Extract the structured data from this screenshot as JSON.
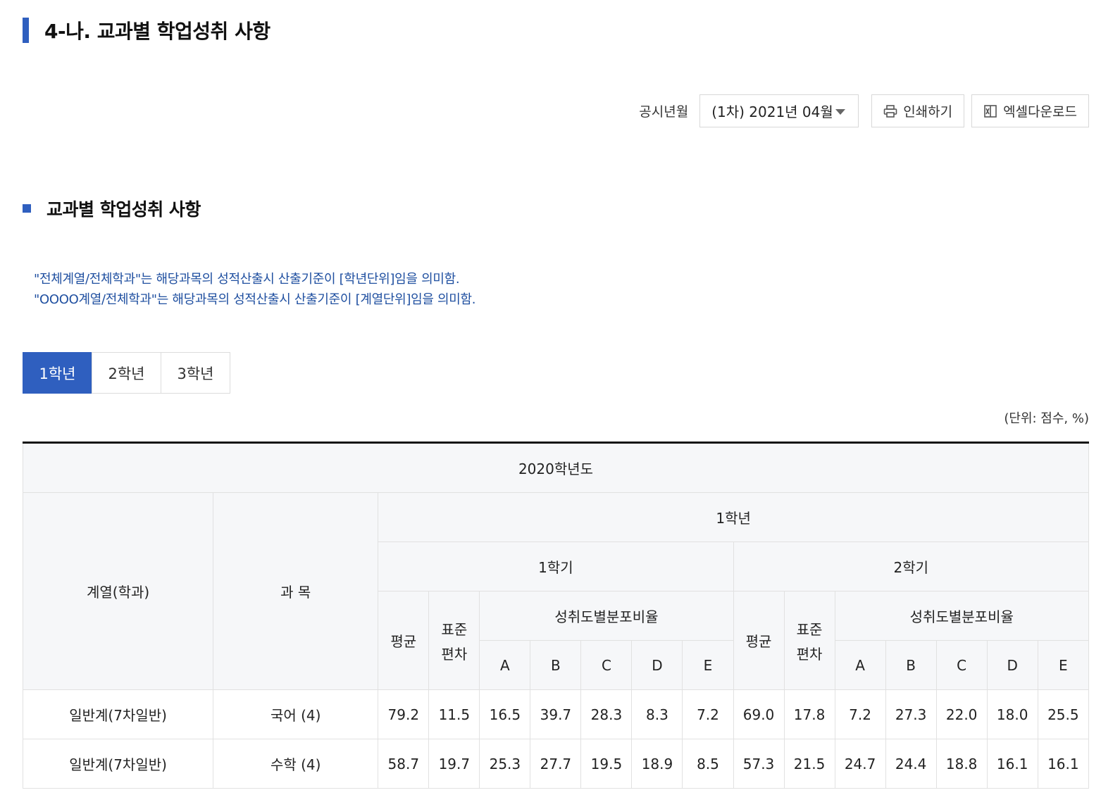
{
  "page_title": "4-나. 교과별 학업성취 사항",
  "toolbar": {
    "label": "공시년월",
    "select_value": "(1차) 2021년 04월",
    "print_label": "인쇄하기",
    "excel_label": "엑셀다운로드"
  },
  "section_title": "교과별 학업성취 사항",
  "notes": [
    "\"전체계열/전체학과\"는 해당과목의 성적산출시 산출기준이 [학년단위]임을 의미함.",
    "\"OOOO계열/전체학과\"는 해당과목의 성적산출시 산출기준이 [계열단위]임을 의미함."
  ],
  "tabs": [
    "1학년",
    "2학년",
    "3학년"
  ],
  "unit": "(단위: 점수, %)",
  "table": {
    "year": "2020학년도",
    "col_dept": "계열(학과)",
    "col_subject": "과 목",
    "grade": "1학년",
    "semesters": [
      "1학기",
      "2학기"
    ],
    "col_avg": "평균",
    "col_std_1": "표준",
    "col_std_2": "편차",
    "col_dist": "성취도별분포비율",
    "grades": [
      "A",
      "B",
      "C",
      "D",
      "E"
    ],
    "rows": [
      {
        "dept": "일반계(7차일반)",
        "subject": "국어 (4)",
        "values": [
          "79.2",
          "11.5",
          "16.5",
          "39.7",
          "28.3",
          "8.3",
          "7.2",
          "69.0",
          "17.8",
          "7.2",
          "27.3",
          "22.0",
          "18.0",
          "25.5"
        ]
      },
      {
        "dept": "일반계(7차일반)",
        "subject": "수학 (4)",
        "values": [
          "58.7",
          "19.7",
          "25.3",
          "27.7",
          "19.5",
          "18.9",
          "8.5",
          "57.3",
          "21.5",
          "24.7",
          "24.4",
          "18.8",
          "16.1",
          "16.1"
        ]
      }
    ]
  }
}
